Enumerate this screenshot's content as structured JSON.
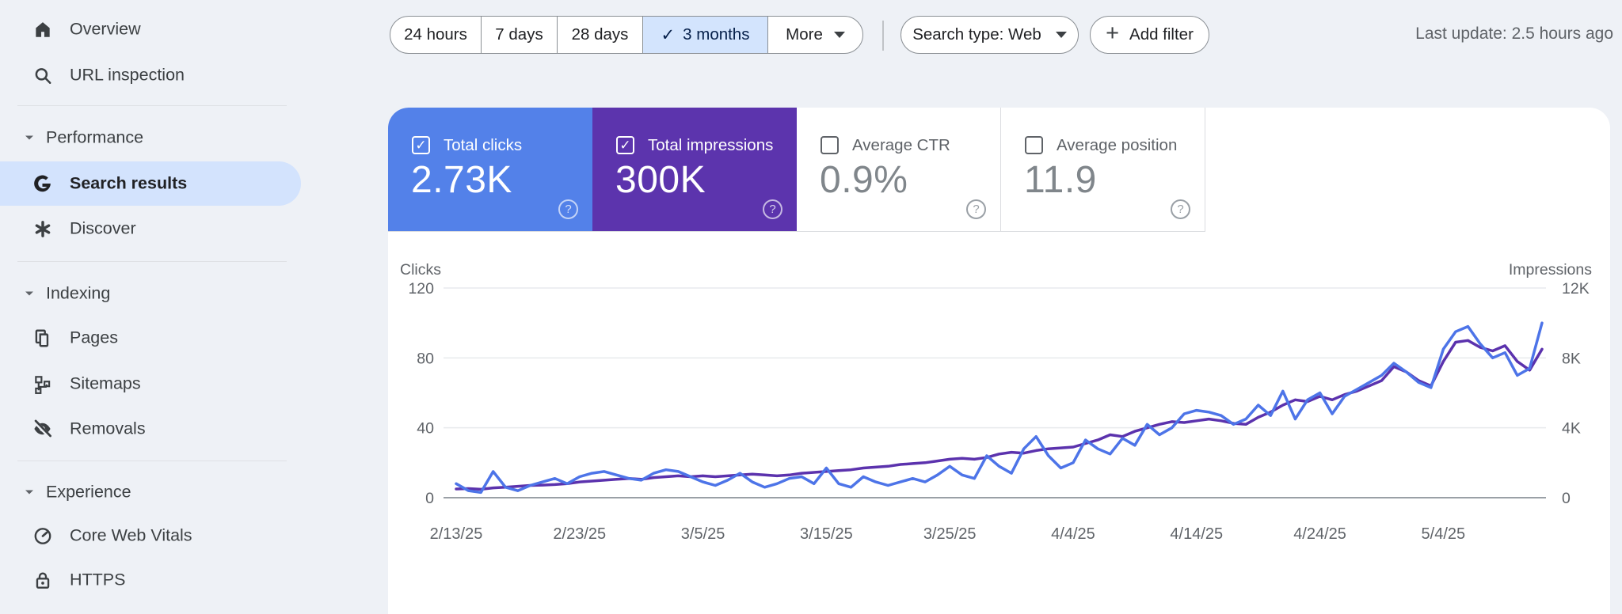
{
  "sidebar": {
    "top_items": [
      {
        "label": "Overview",
        "icon": "home-icon"
      },
      {
        "label": "URL inspection",
        "icon": "search-icon"
      }
    ],
    "sections": [
      {
        "label": "Performance",
        "items": [
          {
            "label": "Search results",
            "icon": "google-g-icon",
            "selected": true
          },
          {
            "label": "Discover",
            "icon": "discover-asterisk-icon",
            "selected": false
          }
        ]
      },
      {
        "label": "Indexing",
        "items": [
          {
            "label": "Pages",
            "icon": "pages-icon",
            "selected": false
          },
          {
            "label": "Sitemaps",
            "icon": "sitemaps-icon",
            "selected": false
          },
          {
            "label": "Removals",
            "icon": "eye-off-icon",
            "selected": false
          }
        ]
      },
      {
        "label": "Experience",
        "items": [
          {
            "label": "Core Web Vitals",
            "icon": "gauge-icon",
            "selected": false
          },
          {
            "label": "HTTPS",
            "icon": "lock-icon",
            "selected": false
          }
        ]
      }
    ],
    "selected_item_bg": "#d3e3fd"
  },
  "toolbar": {
    "date_ranges": [
      {
        "label": "24 hours",
        "selected": false
      },
      {
        "label": "7 days",
        "selected": false
      },
      {
        "label": "28 days",
        "selected": false
      },
      {
        "label": "3 months",
        "selected": true
      },
      {
        "label": "More",
        "selected": false,
        "has_dropdown": true
      }
    ],
    "selected_range_bg": "#d3e4fd",
    "search_type_label": "Search type: Web",
    "add_filter_label": "Add filter",
    "last_update": "Last update: 2.5 hours ago"
  },
  "metrics": {
    "tiles": [
      {
        "label": "Total clicks",
        "value": "2.73K",
        "selected": true,
        "color": "#5381e9"
      },
      {
        "label": "Total impressions",
        "value": "300K",
        "selected": true,
        "color": "#5c34ad"
      },
      {
        "label": "Average CTR",
        "value": "0.9%",
        "selected": false,
        "color": "#ffffff"
      },
      {
        "label": "Average position",
        "value": "11.9",
        "selected": false,
        "color": "#ffffff"
      }
    ]
  },
  "chart_data": {
    "type": "line",
    "grid": true,
    "left_axis": {
      "label": "Clicks",
      "max": 120,
      "ticks": [
        {
          "value": 0,
          "label": "0"
        },
        {
          "value": 40,
          "label": "40"
        },
        {
          "value": 80,
          "label": "80"
        },
        {
          "value": 120,
          "label": "120"
        }
      ]
    },
    "right_axis": {
      "label": "Impressions",
      "max": 12000,
      "ticks": [
        {
          "value": 0,
          "label": "0"
        },
        {
          "value": 4000,
          "label": "4K"
        },
        {
          "value": 8000,
          "label": "8K"
        },
        {
          "value": 12000,
          "label": "12K"
        }
      ]
    },
    "x_ticks": [
      {
        "day": 0,
        "label": "2/13/25"
      },
      {
        "day": 10,
        "label": "2/23/25"
      },
      {
        "day": 20,
        "label": "3/5/25"
      },
      {
        "day": 30,
        "label": "3/15/25"
      },
      {
        "day": 40,
        "label": "3/25/25"
      },
      {
        "day": 50,
        "label": "4/4/25"
      },
      {
        "day": 60,
        "label": "4/14/25"
      },
      {
        "day": 70,
        "label": "4/24/25"
      },
      {
        "day": 80,
        "label": "5/4/25"
      }
    ],
    "series": [
      {
        "name": "Clicks",
        "axis": "left",
        "color": "#4d74e8",
        "values": [
          8,
          4,
          3,
          15,
          6,
          4,
          7,
          9,
          11,
          8,
          12,
          14,
          15,
          13,
          11,
          10,
          14,
          16,
          15,
          12,
          9,
          7,
          10,
          14,
          9,
          6,
          8,
          11,
          12,
          8,
          17,
          8,
          6,
          12,
          9,
          7,
          9,
          11,
          9,
          13,
          18,
          13,
          11,
          24,
          18,
          14,
          28,
          35,
          24,
          17,
          20,
          33,
          28,
          25,
          34,
          30,
          42,
          36,
          40,
          48,
          50,
          49,
          47,
          42,
          45,
          53,
          47,
          61,
          45,
          56,
          60,
          48,
          58,
          62,
          66,
          70,
          77,
          72,
          66,
          63,
          85,
          95,
          98,
          88,
          80,
          83,
          70,
          74,
          100
        ]
      },
      {
        "name": "Impressions",
        "axis": "right",
        "color": "#5b32ad",
        "values": [
          500,
          520,
          480,
          560,
          600,
          650,
          700,
          720,
          750,
          800,
          900,
          950,
          1000,
          1050,
          1100,
          1050,
          1150,
          1200,
          1250,
          1200,
          1250,
          1200,
          1250,
          1300,
          1350,
          1300,
          1250,
          1300,
          1400,
          1450,
          1500,
          1550,
          1600,
          1700,
          1750,
          1800,
          1900,
          1950,
          2000,
          2100,
          2200,
          2250,
          2200,
          2300,
          2500,
          2600,
          2550,
          2700,
          2800,
          2850,
          2900,
          3100,
          3300,
          3600,
          3500,
          3800,
          4000,
          4200,
          4350,
          4300,
          4400,
          4500,
          4400,
          4250,
          4200,
          4600,
          4900,
          5300,
          5600,
          5500,
          5800,
          5600,
          5900,
          6100,
          6400,
          6700,
          7500,
          7200,
          6700,
          6400,
          7800,
          8900,
          9000,
          8600,
          8400,
          8700,
          7800,
          7300,
          8500
        ]
      }
    ]
  }
}
